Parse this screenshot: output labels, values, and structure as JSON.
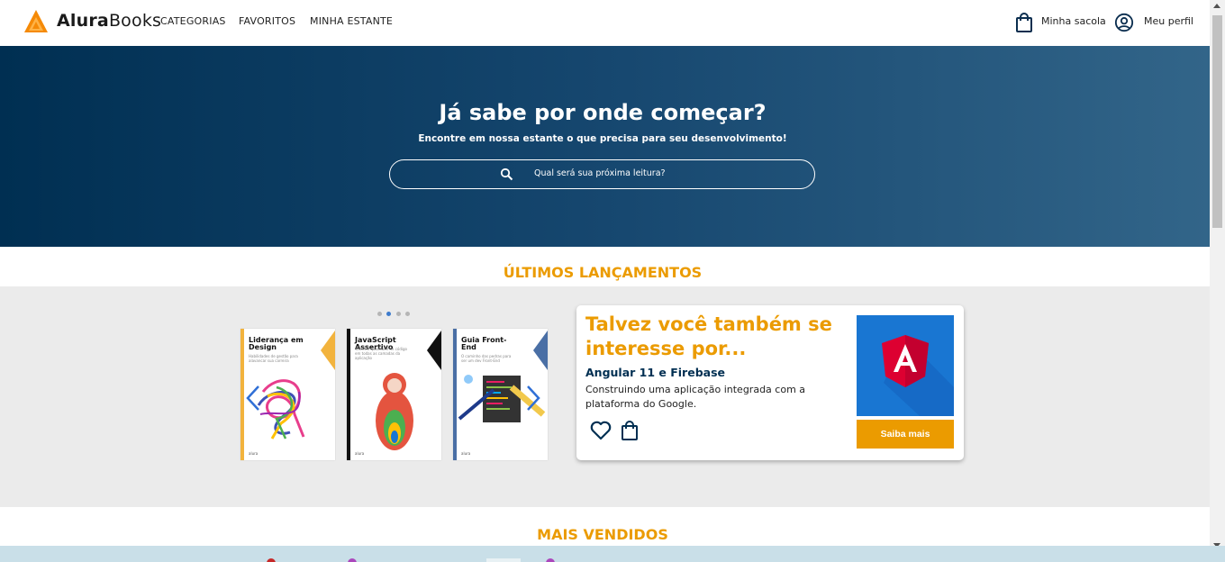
{
  "header": {
    "brand_bold": "Alura",
    "brand_rest": "Books",
    "nav": [
      "CATEGORIAS",
      "FAVORITOS",
      "MINHA ESTANTE"
    ],
    "bag_label": "Minha sacola",
    "profile_label": "Meu perfil"
  },
  "hero": {
    "title": "Já sabe por onde começar?",
    "subtitle": "Encontre em nossa estante o que precisa para seu desenvolvimento!",
    "search_placeholder": "Qual será sua próxima leitura?"
  },
  "releases": {
    "title": "ÚLTIMOS LANÇAMENTOS",
    "dots_count": 4,
    "active_dot": 1,
    "books": [
      {
        "title": "Liderança em Design",
        "subtitle": "Habilidades de gestão para alavancar sua carreira",
        "spine_color": "#f2b33d"
      },
      {
        "title": "JavaScript Assertivo",
        "subtitle": "Testes e qualidade de código em todas as camadas da aplicação",
        "spine_color": "#111111"
      },
      {
        "title": "Guia Front-End",
        "subtitle": "O caminho das pedras para ser um dev Front-End",
        "spine_color": "#4a6fa5"
      }
    ],
    "book_footer": "alura"
  },
  "recommendation": {
    "title": "Talvez você também se interesse por...",
    "book_title": "Angular 11 e Firebase",
    "description": "Construindo uma aplicação integrada com a plataforma do Google.",
    "cta": "Saiba mais",
    "icons": [
      "heart-icon",
      "bag-icon"
    ]
  },
  "bestsellers": {
    "title": "MAIS VENDIDOS"
  },
  "colors": {
    "primary": "#002f52",
    "accent": "#eb9b00",
    "angular_bg": "#1976d2",
    "angular_red": "#dd0031"
  }
}
